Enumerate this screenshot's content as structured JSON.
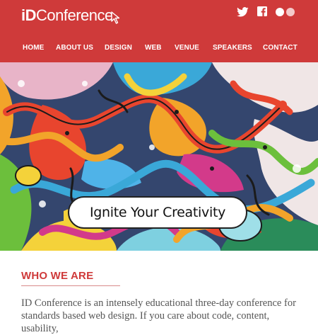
{
  "brand": {
    "logo_prefix": "iD",
    "logo_suffix": "Conference",
    "primary_color": "#cf3a3a"
  },
  "social": {
    "icons": [
      "twitter-icon",
      "facebook-icon",
      "flickr-icon"
    ]
  },
  "nav": {
    "items": [
      {
        "label": "HOME"
      },
      {
        "label": "ABOUT US"
      },
      {
        "label": "DESIGN"
      },
      {
        "label": "WEB"
      },
      {
        "label": "VENUE"
      },
      {
        "label": "SPEAKERS"
      },
      {
        "label": "CONTACT"
      }
    ]
  },
  "hero": {
    "title": "Ignite Your Creativity"
  },
  "about": {
    "heading": "WHO WE ARE",
    "body": "ID Conference is an intensely educational three-day conference for standards based web design. If you care about code, content, usability,"
  }
}
